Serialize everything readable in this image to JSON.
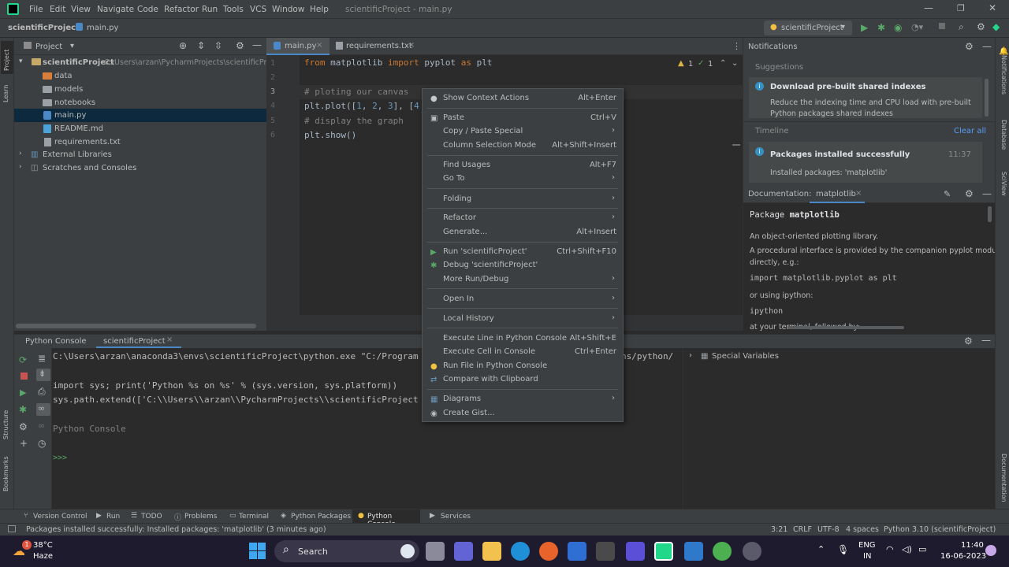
{
  "window": {
    "title": "scientificProject - main.py",
    "menu": [
      "File",
      "Edit",
      "View",
      "Navigate",
      "Code",
      "Refactor",
      "Run",
      "Tools",
      "VCS",
      "Window",
      "Help"
    ]
  },
  "navbar": {
    "project": "scientificProject",
    "file": "main.py",
    "run_config": "scientificProject"
  },
  "project_panel": {
    "title": "Project",
    "root_name": "scientificProject",
    "root_path": "C:\\Users\\arzan\\PycharmProjects\\scientificProje",
    "items": [
      {
        "label": "data"
      },
      {
        "label": "models"
      },
      {
        "label": "notebooks"
      },
      {
        "label": "main.py"
      },
      {
        "label": "README.md"
      },
      {
        "label": "requirements.txt"
      },
      {
        "label": "External Libraries"
      },
      {
        "label": "Scratches and Consoles"
      }
    ]
  },
  "editor": {
    "tabs": [
      {
        "label": "main.py"
      },
      {
        "label": "requirements.txt"
      }
    ],
    "inspection": {
      "warnings": "1",
      "checks": "1"
    },
    "lines": [
      {
        "num": "1"
      },
      {
        "num": "2"
      },
      {
        "num": "3"
      },
      {
        "num": "4"
      },
      {
        "num": "5"
      },
      {
        "num": "6"
      }
    ],
    "code": {
      "l1_from": "from",
      "l1_mod": " matplotlib ",
      "l1_import": "import",
      "l1_rest": " pyplot ",
      "l1_as": "as",
      "l1_alias": " plt",
      "l3": "# ploting our canvas",
      "l4_a": "plt.plot([",
      "l4_n1": "1",
      "l4_c1": ", ",
      "l4_n2": "2",
      "l4_c2": ", ",
      "l4_n3": "3",
      "l4_c3": "], [",
      "l4_n4": "4",
      "l5": "# display the graph",
      "l6": "plt.show()"
    }
  },
  "context_menu": {
    "items": [
      {
        "label": "Show Context Actions",
        "shortcut": "Alt+Enter"
      },
      {
        "label": "Paste",
        "shortcut": "Ctrl+V"
      },
      {
        "label": "Copy / Paste Special",
        "shortcut": ""
      },
      {
        "label": "Column Selection Mode",
        "shortcut": "Alt+Shift+Insert"
      },
      {
        "label": "Find Usages",
        "shortcut": "Alt+F7"
      },
      {
        "label": "Go To",
        "shortcut": ""
      },
      {
        "label": "Folding",
        "shortcut": ""
      },
      {
        "label": "Refactor",
        "shortcut": ""
      },
      {
        "label": "Generate...",
        "shortcut": "Alt+Insert"
      },
      {
        "label": "Run 'scientificProject'",
        "shortcut": "Ctrl+Shift+F10"
      },
      {
        "label": "Debug 'scientificProject'",
        "shortcut": ""
      },
      {
        "label": "More Run/Debug",
        "shortcut": ""
      },
      {
        "label": "Open In",
        "shortcut": ""
      },
      {
        "label": "Local History",
        "shortcut": ""
      },
      {
        "label": "Execute Line in Python Console",
        "shortcut": "Alt+Shift+E"
      },
      {
        "label": "Execute Cell in Console",
        "shortcut": "Ctrl+Enter"
      },
      {
        "label": "Run File in Python Console",
        "shortcut": ""
      },
      {
        "label": "Compare with Clipboard",
        "shortcut": ""
      },
      {
        "label": "Diagrams",
        "shortcut": ""
      },
      {
        "label": "Create Gist...",
        "shortcut": ""
      }
    ]
  },
  "notifications": {
    "title": "Notifications",
    "suggestions_label": "Suggestions",
    "suggestion_title": "Download pre-built shared indexes",
    "suggestion_body1": "Reduce the indexing time and CPU load with pre-built",
    "suggestion_body2": "Python packages shared indexes",
    "timeline_label": "Timeline",
    "clear_all": "Clear all",
    "event_title": "Packages installed successfully",
    "event_time": "11:37",
    "event_body": "Installed packages: 'matplotlib'"
  },
  "documentation": {
    "label": "Documentation:",
    "tab": "matplotlib",
    "package_prefix": "Package ",
    "package_name": "matplotlib",
    "desc1": "An object-oriented plotting library.",
    "desc2": "A procedural interface is provided by the companion pyplot module",
    "desc3": "directly, e.g.:",
    "code1": "import matplotlib.pyplot as plt",
    "desc4": "or using ipython:",
    "code2": "ipython",
    "desc5": "at your terminal, followed by:"
  },
  "console": {
    "tabs": [
      {
        "label": "Python Console"
      },
      {
        "label": "scientificProject"
      }
    ],
    "line1": "C:\\Users\\arzan\\anaconda3\\envs\\scientificProject\\python.exe \"C:/Program",
    "line1_tail": "ns/python/",
    "line2": "import sys; print('Python %s on %s' % (sys.version, sys.platform))",
    "line3": "sys.path.extend(['C:\\\\Users\\\\arzan\\\\PycharmProjects\\\\scientificProject",
    "line4": "Python Console",
    "prompt": ">>>",
    "special_vars": "Special Variables"
  },
  "tool_strip": {
    "items": [
      "Version Control",
      "Run",
      "TODO",
      "Problems",
      "Terminal",
      "Python Packages",
      "Python Console",
      "Services"
    ]
  },
  "left_strip": {
    "project": "Project",
    "learn": "Learn",
    "structure": "Structure",
    "bookmarks": "Bookmarks"
  },
  "right_strip": {
    "notifications": "Notifications",
    "database": "Database",
    "sciview": "SciView",
    "documentation": "Documentation"
  },
  "status_bar": {
    "message": "Packages installed successfully: Installed packages: 'matplotlib' (3 minutes ago)",
    "position": "3:21",
    "line_sep": "CRLF",
    "encoding": "UTF-8",
    "indent": "4 spaces",
    "interpreter": "Python 3.10 (scientificProject)"
  },
  "taskbar": {
    "temp": "38°C",
    "weather": "Haze",
    "weather_badge": "1",
    "search": "Search",
    "lang1": "ENG",
    "lang2": "IN",
    "time": "11:40",
    "date": "16-06-2023"
  }
}
